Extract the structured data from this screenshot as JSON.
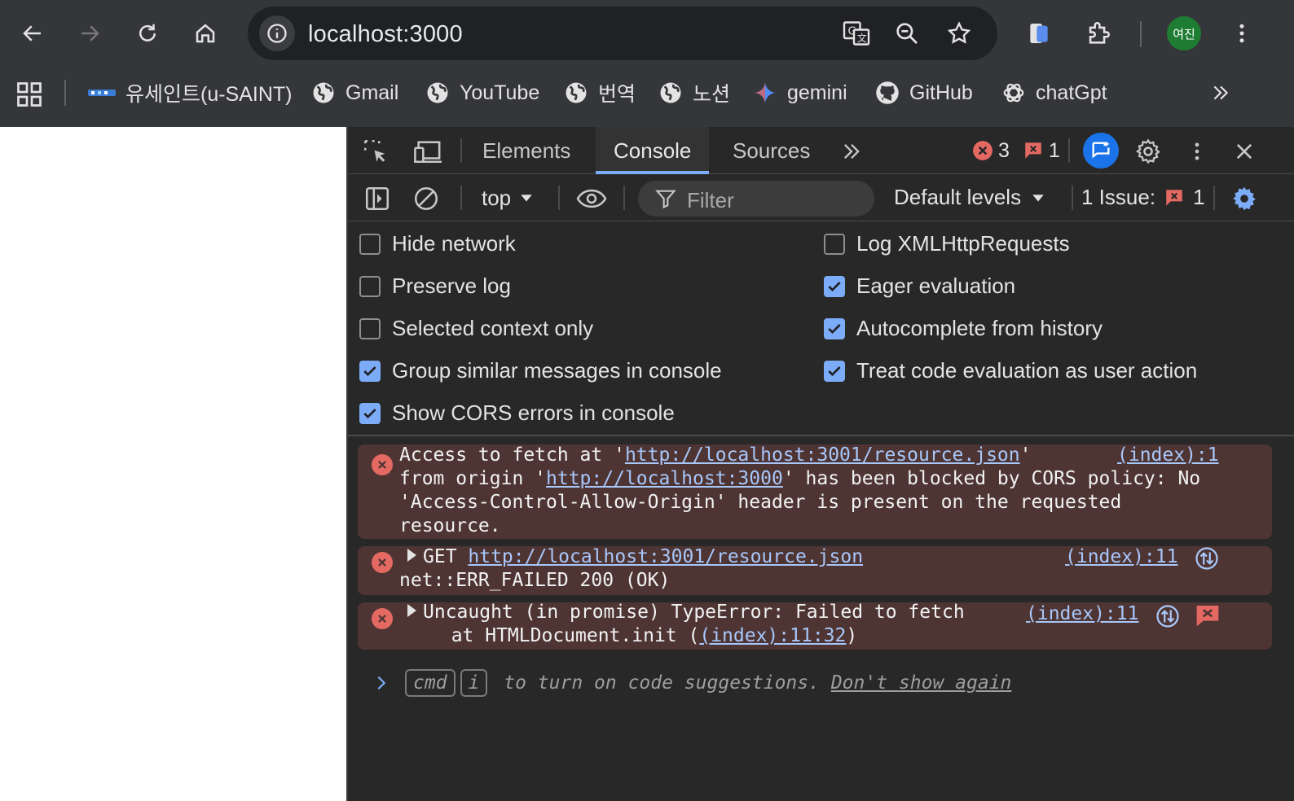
{
  "browser": {
    "url": "localhost:3000",
    "avatar_label": "여진"
  },
  "bookmarks": [
    {
      "label": "유세인트(u-SAINT)",
      "icon": "usaint-icon"
    },
    {
      "label": "Gmail",
      "icon": "globe-icon"
    },
    {
      "label": "YouTube",
      "icon": "globe-icon"
    },
    {
      "label": "번역",
      "icon": "globe-icon"
    },
    {
      "label": "노션",
      "icon": "globe-icon"
    },
    {
      "label": "gemini",
      "icon": "gemini-icon"
    },
    {
      "label": "GitHub",
      "icon": "github-icon"
    },
    {
      "label": "chatGpt",
      "icon": "chatgpt-icon"
    }
  ],
  "devtools": {
    "tabs": [
      "Elements",
      "Console",
      "Sources"
    ],
    "active_tab": "Console",
    "error_count": "3",
    "issue_badge_count": "1",
    "context": "top",
    "filter_placeholder": "Filter",
    "levels": "Default levels",
    "issues_label": "1 Issue:",
    "issues_count": "1"
  },
  "settings": {
    "left": [
      {
        "label": "Hide network",
        "checked": false
      },
      {
        "label": "Preserve log",
        "checked": false
      },
      {
        "label": "Selected context only",
        "checked": false
      },
      {
        "label": "Group similar messages in console",
        "checked": true
      },
      {
        "label": "Show CORS errors in console",
        "checked": true
      }
    ],
    "right": [
      {
        "label": "Log XMLHttpRequests",
        "checked": false
      },
      {
        "label": "Eager evaluation",
        "checked": true
      },
      {
        "label": "Autocomplete from history",
        "checked": true
      },
      {
        "label": "Treat code evaluation as user action",
        "checked": true
      }
    ]
  },
  "messages": {
    "m1": {
      "pre": "Access to fetch at '",
      "url": "http://localhost:3001/resource.json",
      "post1": "'",
      "line2_pre": "from origin '",
      "origin": "http://localhost:3000",
      "line2_post": "' has been blocked by CORS policy: No",
      "line3": "'Access-Control-Allow-Origin' header is present on the requested",
      "line4": "resource.",
      "source": "(index):1"
    },
    "m2": {
      "method": "GET ",
      "url": "http://localhost:3001/resource.json",
      "line2": "net::ERR_FAILED 200 (OK)",
      "source": "(index):11"
    },
    "m3": {
      "line1": "Uncaught (in promise) TypeError: Failed to fetch",
      "line2_pre": "  at HTMLDocument.init (",
      "line2_link": "(index):11:32",
      "line2_post": ")",
      "source": "(index):11"
    }
  },
  "prompt": {
    "key1": "cmd",
    "key2": "i",
    "text": " to turn on code suggestions. ",
    "dismiss": "Don't show again"
  },
  "colors": {
    "accent": "#7cacf8",
    "error_bg": "#4e3534",
    "error_icon": "#e46962",
    "link": "#a8c7fa"
  }
}
